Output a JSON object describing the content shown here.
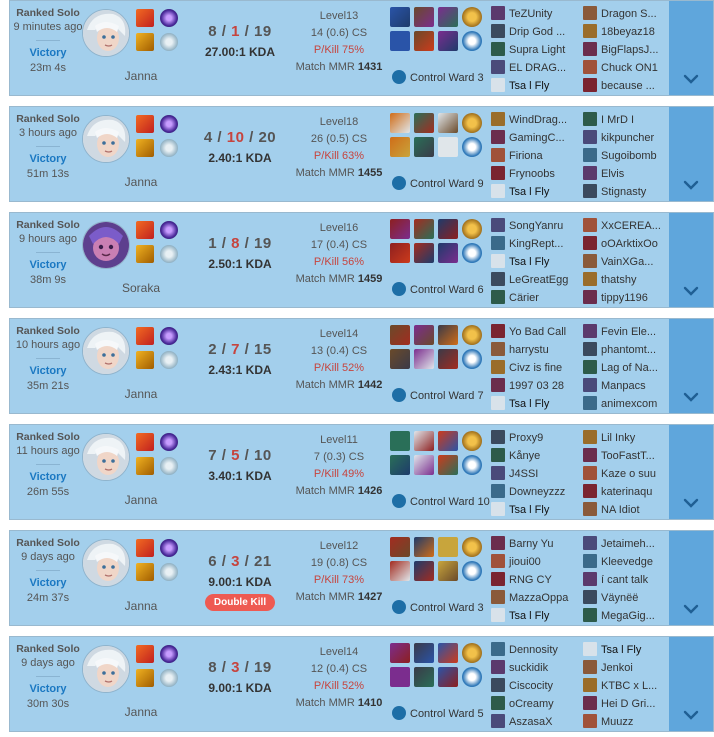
{
  "games": [
    {
      "queue": "Ranked Solo",
      "ago": "9 minutes ago",
      "result": "Victory",
      "length": "23m 4s",
      "champion": "Janna",
      "k": "8",
      "d": "1",
      "a": "19",
      "kda": "27.00:1 KDA",
      "badge": "",
      "level": "Level13",
      "cs": "14 (0.6) CS",
      "pkill": "P/Kill 75%",
      "mmr_label": "Match MMR",
      "mmr": "1431",
      "ward": "Control Ward 3",
      "team1": [
        "TeZUnity",
        "Drip God ...",
        "Supra Light",
        "EL DRAG...",
        "Tsa l Fly"
      ],
      "team2": [
        "Dragon S...",
        "18beyaz18",
        "BigFlapsJ...",
        "Chuck ON1",
        "because ..."
      ],
      "me_team": 1,
      "me_index": 4
    },
    {
      "queue": "Ranked Solo",
      "ago": "3 hours ago",
      "result": "Victory",
      "length": "51m 13s",
      "champion": "Janna",
      "k": "4",
      "d": "10",
      "a": "20",
      "kda": "2.40:1 KDA",
      "badge": "",
      "level": "Level18",
      "cs": "26 (0.5) CS",
      "pkill": "P/Kill 63%",
      "mmr_label": "Match MMR",
      "mmr": "1455",
      "ward": "Control Ward 9",
      "team1": [
        "WindDrag...",
        "GamingC...",
        "Firiona",
        "Frynoobs",
        "Tsa l Fly"
      ],
      "team2": [
        "I MrD I",
        "kikpuncher",
        "Sugoibomb",
        "Elvis",
        "Stignasty"
      ],
      "me_team": 1,
      "me_index": 4
    },
    {
      "queue": "Ranked Solo",
      "ago": "9 hours ago",
      "result": "Victory",
      "length": "38m 9s",
      "champion": "Soraka",
      "k": "1",
      "d": "8",
      "a": "19",
      "kda": "2.50:1 KDA",
      "badge": "",
      "level": "Level16",
      "cs": "17 (0.4) CS",
      "pkill": "P/Kill 56%",
      "mmr_label": "Match MMR",
      "mmr": "1459",
      "ward": "Control Ward 6",
      "team1": [
        "SongYanru",
        "KingRept...",
        "Tsa l Fly",
        "LeGreatEgg",
        "Cärier"
      ],
      "team2": [
        "XxCEREA...",
        "oOArktixOo",
        "VainXGa...",
        "thatshy",
        "tippy1196"
      ],
      "me_team": 1,
      "me_index": 2
    },
    {
      "queue": "Ranked Solo",
      "ago": "10 hours ago",
      "result": "Victory",
      "length": "35m 21s",
      "champion": "Janna",
      "k": "2",
      "d": "7",
      "a": "15",
      "kda": "2.43:1 KDA",
      "badge": "",
      "level": "Level14",
      "cs": "13 (0.4) CS",
      "pkill": "P/Kill 52%",
      "mmr_label": "Match MMR",
      "mmr": "1442",
      "ward": "Control Ward 7",
      "team1": [
        "Yo Bad Call",
        "harrystu",
        "Civz is fine",
        "1997 03 28",
        "Tsa l Fly"
      ],
      "team2": [
        "Fevin Ele...",
        "phantomt...",
        "Lag of Na...",
        "Manpacs",
        "animexcom"
      ],
      "me_team": 1,
      "me_index": 4
    },
    {
      "queue": "Ranked Solo",
      "ago": "11 hours ago",
      "result": "Victory",
      "length": "26m 55s",
      "champion": "Janna",
      "k": "7",
      "d": "5",
      "a": "10",
      "kda": "3.40:1 KDA",
      "badge": "",
      "level": "Level11",
      "cs": "7 (0.3) CS",
      "pkill": "P/Kill 49%",
      "mmr_label": "Match MMR",
      "mmr": "1426",
      "ward": "Control Ward 10",
      "team1": [
        "Proxy9",
        "Kånye",
        "J4SSI",
        "Downeyzzz",
        "Tsa l Fly"
      ],
      "team2": [
        "Lil Inky",
        "TooFastT...",
        "Kaze o suu",
        "katerinaqu",
        "NA Idiot"
      ],
      "me_team": 1,
      "me_index": 4
    },
    {
      "queue": "Ranked Solo",
      "ago": "9 days ago",
      "result": "Victory",
      "length": "24m 37s",
      "champion": "Janna",
      "k": "6",
      "d": "3",
      "a": "21",
      "kda": "9.00:1 KDA",
      "badge": "Double Kill",
      "level": "Level12",
      "cs": "19 (0.8) CS",
      "pkill": "P/Kill 73%",
      "mmr_label": "Match MMR",
      "mmr": "1427",
      "ward": "Control Ward 3",
      "team1": [
        "Barny Yu",
        "jioui00",
        "RNG CY",
        "MazzaOppa",
        "Tsa l Fly"
      ],
      "team2": [
        "Jetaimeh...",
        "Kleevedge",
        "í cant talk",
        "Väynëë",
        "MegaGig..."
      ],
      "me_team": 1,
      "me_index": 4
    },
    {
      "queue": "Ranked Solo",
      "ago": "9 days ago",
      "result": "Victory",
      "length": "30m 30s",
      "champion": "Janna",
      "k": "8",
      "d": "3",
      "a": "19",
      "kda": "9.00:1 KDA",
      "badge": "",
      "level": "Level14",
      "cs": "12 (0.4) CS",
      "pkill": "P/Kill 52%",
      "mmr_label": "Match MMR",
      "mmr": "1410",
      "ward": "Control Ward 5",
      "team1": [
        "Dennosity",
        "suckidik",
        "Ciscocity",
        "oCreamy",
        "AszasaX"
      ],
      "team2": [
        "Tsa l Fly",
        "Jenkoi",
        "KTBC x L...",
        "Hei D Gri...",
        "Muuzz"
      ],
      "me_team": 2,
      "me_index": 0
    }
  ],
  "colors": {
    "row_bg": "#a3cfec",
    "expand_bg": "#5fa6dc",
    "victory": "#1a78c2",
    "death": "#c6443e",
    "badge": "#ee5a52"
  },
  "icons": {
    "expand": "chevron-down-icon",
    "ward": "control-ward-icon"
  }
}
